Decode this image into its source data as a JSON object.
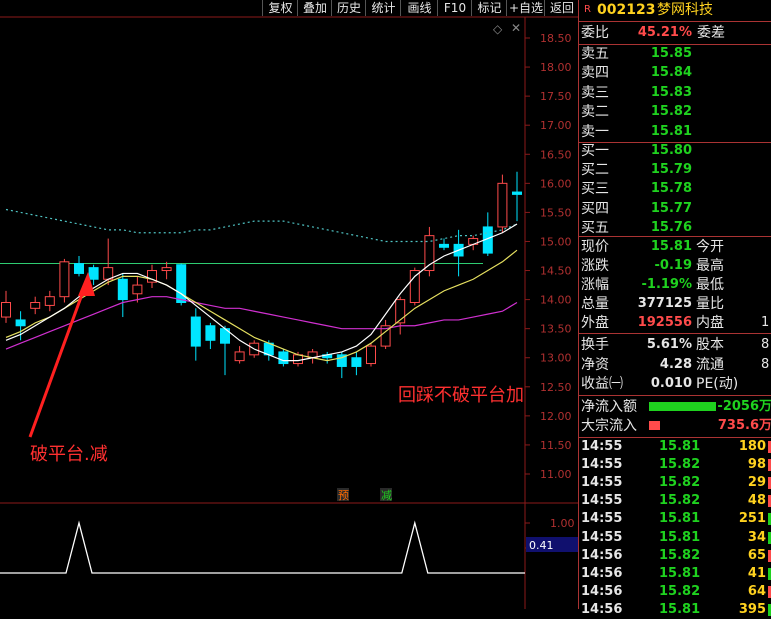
{
  "toolbar": {
    "buttons": [
      "复权",
      "叠加",
      "历史",
      "统计",
      "画线",
      "F10",
      "标记",
      "+自选",
      "返回"
    ]
  },
  "chart_data": {
    "type": "candlestick",
    "ylim": [
      11.0,
      18.5
    ],
    "yticks": [
      "18.50",
      "18.00",
      "17.50",
      "17.00",
      "16.50",
      "16.00",
      "15.50",
      "15.00",
      "14.50",
      "14.00",
      "13.50",
      "13.00",
      "12.50",
      "12.00",
      "11.50",
      "11.00"
    ],
    "platform_level": 14.62,
    "candles": [
      {
        "o": 13.7,
        "h": 14.15,
        "l": 13.6,
        "c": 13.95
      },
      {
        "o": 13.65,
        "h": 13.8,
        "l": 13.3,
        "c": 13.55
      },
      {
        "o": 13.85,
        "h": 14.05,
        "l": 13.75,
        "c": 13.95
      },
      {
        "o": 13.9,
        "h": 14.15,
        "l": 13.8,
        "c": 14.05
      },
      {
        "o": 14.05,
        "h": 14.7,
        "l": 13.95,
        "c": 14.65
      },
      {
        "o": 14.62,
        "h": 14.75,
        "l": 14.4,
        "c": 14.45
      },
      {
        "o": 14.55,
        "h": 14.6,
        "l": 14.25,
        "c": 14.35
      },
      {
        "o": 14.35,
        "h": 15.05,
        "l": 14.25,
        "c": 14.55
      },
      {
        "o": 14.35,
        "h": 14.45,
        "l": 13.7,
        "c": 14.0
      },
      {
        "o": 14.1,
        "h": 14.4,
        "l": 13.95,
        "c": 14.25
      },
      {
        "o": 14.3,
        "h": 14.6,
        "l": 14.2,
        "c": 14.5
      },
      {
        "o": 14.5,
        "h": 14.65,
        "l": 14.35,
        "c": 14.55
      },
      {
        "o": 14.6,
        "h": 14.62,
        "l": 13.9,
        "c": 13.95
      },
      {
        "o": 13.7,
        "h": 13.85,
        "l": 12.95,
        "c": 13.2
      },
      {
        "o": 13.55,
        "h": 13.6,
        "l": 13.15,
        "c": 13.3
      },
      {
        "o": 13.5,
        "h": 13.55,
        "l": 12.7,
        "c": 13.25
      },
      {
        "o": 12.95,
        "h": 13.2,
        "l": 12.9,
        "c": 13.1
      },
      {
        "o": 13.05,
        "h": 13.3,
        "l": 13.0,
        "c": 13.25
      },
      {
        "o": 13.25,
        "h": 13.3,
        "l": 12.95,
        "c": 13.05
      },
      {
        "o": 13.1,
        "h": 13.15,
        "l": 12.85,
        "c": 12.9
      },
      {
        "o": 12.9,
        "h": 13.1,
        "l": 12.85,
        "c": 13.05
      },
      {
        "o": 13.0,
        "h": 13.15,
        "l": 12.9,
        "c": 13.1
      },
      {
        "o": 13.05,
        "h": 13.1,
        "l": 12.9,
        "c": 13.0
      },
      {
        "o": 13.05,
        "h": 13.1,
        "l": 12.65,
        "c": 12.85
      },
      {
        "o": 13.0,
        "h": 13.1,
        "l": 12.7,
        "c": 12.85
      },
      {
        "o": 12.9,
        "h": 13.25,
        "l": 12.85,
        "c": 13.2
      },
      {
        "o": 13.2,
        "h": 13.65,
        "l": 13.15,
        "c": 13.55
      },
      {
        "o": 13.6,
        "h": 14.05,
        "l": 13.4,
        "c": 14.0
      },
      {
        "o": 13.95,
        "h": 14.55,
        "l": 13.9,
        "c": 14.5
      },
      {
        "o": 14.5,
        "h": 15.25,
        "l": 14.4,
        "c": 15.1
      },
      {
        "o": 14.95,
        "h": 15.05,
        "l": 14.85,
        "c": 14.9
      },
      {
        "o": 14.95,
        "h": 15.2,
        "l": 14.4,
        "c": 14.75
      },
      {
        "o": 14.95,
        "h": 15.1,
        "l": 14.85,
        "c": 15.05
      },
      {
        "o": 15.25,
        "h": 15.5,
        "l": 14.75,
        "c": 14.8
      },
      {
        "o": 15.25,
        "h": 16.15,
        "l": 15.15,
        "c": 16.0
      },
      {
        "o": 15.85,
        "h": 16.2,
        "l": 15.35,
        "c": 15.81
      }
    ],
    "ma_white": [
      13.3,
      13.4,
      13.55,
      13.7,
      13.85,
      14.05,
      14.2,
      14.35,
      14.45,
      14.45,
      14.35,
      14.25,
      14.1,
      13.9,
      13.7,
      13.5,
      13.3,
      13.15,
      13.05,
      12.95,
      12.95,
      13.0,
      13.05,
      13.1,
      13.2,
      13.4,
      13.75,
      14.1,
      14.4,
      14.6,
      14.75,
      14.85,
      14.95,
      15.05,
      15.15,
      15.3
    ],
    "ma_yellow": [
      13.35,
      13.45,
      13.6,
      13.7,
      13.85,
      14.0,
      14.15,
      14.3,
      14.4,
      14.4,
      14.35,
      14.25,
      14.1,
      13.95,
      13.8,
      13.65,
      13.5,
      13.35,
      13.25,
      13.15,
      13.05,
      13.0,
      12.95,
      13.0,
      13.1,
      13.25,
      13.45,
      13.65,
      13.85,
      14.0,
      14.15,
      14.25,
      14.35,
      14.5,
      14.65,
      14.85
    ],
    "ma_magenta": [
      13.15,
      13.25,
      13.35,
      13.45,
      13.55,
      13.65,
      13.75,
      13.85,
      13.95,
      14.0,
      14.05,
      14.05,
      14.0,
      13.95,
      13.9,
      13.85,
      13.85,
      13.8,
      13.75,
      13.7,
      13.65,
      13.6,
      13.55,
      13.5,
      13.5,
      13.5,
      13.5,
      13.55,
      13.55,
      13.6,
      13.65,
      13.65,
      13.7,
      13.75,
      13.8,
      13.95
    ],
    "ma_cyan_dashed": [
      15.55,
      15.5,
      15.45,
      15.4,
      15.35,
      15.3,
      15.25,
      15.2,
      15.2,
      15.15,
      15.15,
      15.15,
      15.15,
      15.2,
      15.2,
      15.25,
      15.3,
      15.35,
      15.35,
      15.35,
      15.3,
      15.25,
      15.2,
      15.15,
      15.1,
      15.05,
      15.0,
      15.0,
      15.0,
      15.0,
      15.05,
      15.1,
      15.1,
      15.15,
      15.2,
      15.3
    ],
    "markers": [
      {
        "label": "预",
        "color": "#ff6a00"
      },
      {
        "label": "减",
        "color": "#1fd21f"
      }
    ],
    "annotations": {
      "left": "破平台.减",
      "right": "回踩不破平台加"
    },
    "oscillator": {
      "ylim": [
        0,
        1.2
      ],
      "yticks": [
        "1.00",
        "0.50"
      ],
      "current": "0.41",
      "values": [
        0,
        0,
        0,
        0,
        0,
        1,
        0,
        0,
        0,
        0,
        0,
        0,
        0,
        0,
        0,
        0,
        0,
        0,
        0,
        0,
        0,
        0,
        0,
        0,
        0,
        0,
        0,
        0,
        1,
        0,
        0,
        0,
        0,
        0,
        0,
        0
      ]
    }
  },
  "quote": {
    "r_badge": "R",
    "code": "002123",
    "name": "梦网科技",
    "weibi_label": "委比",
    "weibi_value": "45.21%",
    "weicha_label": "委差",
    "asks": [
      {
        "label": "卖五",
        "price": "15.85"
      },
      {
        "label": "卖四",
        "price": "15.84"
      },
      {
        "label": "卖三",
        "price": "15.83"
      },
      {
        "label": "卖二",
        "price": "15.82"
      },
      {
        "label": "卖一",
        "price": "15.81"
      }
    ],
    "bids": [
      {
        "label": "买一",
        "price": "15.80"
      },
      {
        "label": "买二",
        "price": "15.79"
      },
      {
        "label": "买三",
        "price": "15.78"
      },
      {
        "label": "买四",
        "price": "15.77"
      },
      {
        "label": "买五",
        "price": "15.76"
      }
    ],
    "stats": [
      {
        "l": "现价",
        "v": "15.81",
        "vc": "green",
        "l2": "今开",
        "v2": ""
      },
      {
        "l": "涨跌",
        "v": "-0.19",
        "vc": "green",
        "l2": "最高",
        "v2": ""
      },
      {
        "l": "涨幅",
        "v": "-1.19%",
        "vc": "green",
        "l2": "最低",
        "v2": ""
      },
      {
        "l": "总量",
        "v": "377125",
        "vc": "white",
        "l2": "量比",
        "v2": ""
      },
      {
        "l": "外盘",
        "v": "192556",
        "vc": "red",
        "l2": "内盘",
        "v2": "1"
      }
    ],
    "stats2": [
      {
        "l": "换手",
        "v": "5.61%",
        "l2": "股本",
        "v2": "8"
      },
      {
        "l": "净资",
        "v": "4.28",
        "l2": "流通",
        "v2": "8"
      },
      {
        "l": "收益㈠",
        "v": "0.010",
        "l2": "PE(动)",
        "v2": ""
      }
    ],
    "flows": [
      {
        "l": "净流入额",
        "v": "-2056万",
        "bar": "#1fd21f",
        "barw": 86
      },
      {
        "l": "大宗流入",
        "v": "735.6万",
        "bar": "#ff4b4b",
        "barw": 14
      }
    ],
    "ticks": [
      {
        "t": "14:55",
        "p": "15.81",
        "v": "180",
        "d": "red"
      },
      {
        "t": "14:55",
        "p": "15.82",
        "v": "98",
        "d": "red"
      },
      {
        "t": "14:55",
        "p": "15.82",
        "v": "29",
        "d": "red"
      },
      {
        "t": "14:55",
        "p": "15.82",
        "v": "48",
        "d": "red"
      },
      {
        "t": "14:55",
        "p": "15.81",
        "v": "251",
        "d": "green"
      },
      {
        "t": "14:55",
        "p": "15.81",
        "v": "34",
        "d": "green"
      },
      {
        "t": "14:56",
        "p": "15.82",
        "v": "65",
        "d": "red"
      },
      {
        "t": "14:56",
        "p": "15.81",
        "v": "41",
        "d": "green"
      },
      {
        "t": "14:56",
        "p": "15.82",
        "v": "64",
        "d": "red"
      },
      {
        "t": "14:56",
        "p": "15.81",
        "v": "395",
        "d": "green"
      }
    ],
    "colors": {
      "up": "#ff4b4b",
      "down": "#00e5ff",
      "green": "#1fd21f",
      "grid": "#8b1a1a"
    }
  }
}
